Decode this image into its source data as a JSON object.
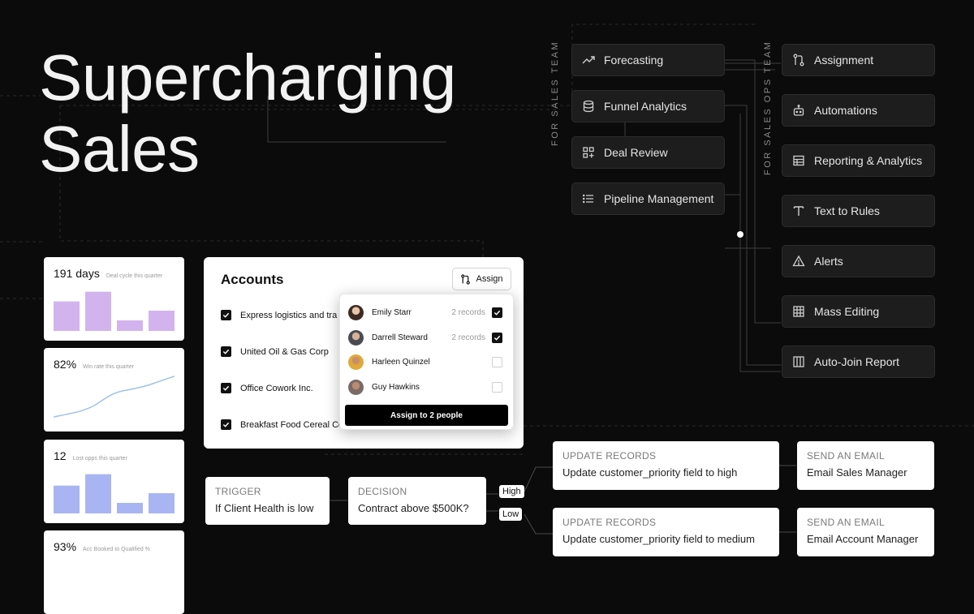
{
  "hero": {
    "line1": "Supercharging",
    "line2": "Sales"
  },
  "sales_team": {
    "label": "FOR SALES TEAM",
    "items": [
      {
        "label": "Forecasting",
        "icon": "trend-icon"
      },
      {
        "label": "Funnel Analytics",
        "icon": "database-icon"
      },
      {
        "label": "Deal Review",
        "icon": "grid-plus-icon"
      },
      {
        "label": "Pipeline Management",
        "icon": "list-icon"
      }
    ]
  },
  "sales_ops_team": {
    "label": "FOR SALES OPS TEAM",
    "items": [
      {
        "label": "Assignment",
        "icon": "git-branch-icon"
      },
      {
        "label": "Automations",
        "icon": "robot-icon"
      },
      {
        "label": "Reporting & Analytics",
        "icon": "table-icon"
      },
      {
        "label": "Text to Rules",
        "icon": "text-icon"
      },
      {
        "label": "Alerts",
        "icon": "warning-icon"
      },
      {
        "label": "Mass Editing",
        "icon": "grid-icon"
      },
      {
        "label": "Auto-Join Report",
        "icon": "columns-icon"
      }
    ]
  },
  "stats": [
    {
      "value": "191 days",
      "caption": "Deal cycle this quarter",
      "kind": "bar",
      "color": "#d3b3ee",
      "bars": [
        0.7,
        0.93,
        0.25,
        0.48
      ]
    },
    {
      "value": "82%",
      "caption": "Win rate this quarter",
      "kind": "line",
      "color": "#9fc2ea"
    },
    {
      "value": "12",
      "caption": "Lost opps this quarter",
      "kind": "bar",
      "color": "#a9b5f2",
      "bars": [
        0.66,
        0.93,
        0.25,
        0.48
      ]
    },
    {
      "value": "93%",
      "caption": "Acc Booked to Qualified %"
    }
  ],
  "accounts": {
    "title": "Accounts",
    "assign_label": "Assign",
    "rows": [
      {
        "name": "Express logistics and transport",
        "checked": true
      },
      {
        "name": "United Oil & Gas Corp",
        "checked": true
      },
      {
        "name": "Office Cowork Inc.",
        "checked": true
      },
      {
        "name": "Breakfast Food Cereal Corp",
        "checked": true
      }
    ]
  },
  "assign_popup": {
    "people": [
      {
        "name": "Emily Starr",
        "records": "2 records",
        "checked": true
      },
      {
        "name": "Darrell Steward",
        "records": "2 records",
        "checked": true
      },
      {
        "name": "Harleen Quinzel",
        "records": "",
        "checked": false
      },
      {
        "name": "Guy Hawkins",
        "records": "",
        "checked": false
      }
    ],
    "button_label": "Assign to 2 people"
  },
  "workflow": {
    "trigger": {
      "kicker": "TRIGGER",
      "text": "If Client Health is low"
    },
    "decision": {
      "kicker": "DECISION",
      "text": "Contract above $500K?"
    },
    "high_label": "High",
    "low_label": "Low",
    "update_high": {
      "kicker": "UPDATE RECORDS",
      "text": "Update customer_priority field to high"
    },
    "update_low": {
      "kicker": "UPDATE RECORDS",
      "text": "Update customer_priority field to medium"
    },
    "email_high": {
      "kicker": "SEND AN EMAIL",
      "text": "Email Sales Manager"
    },
    "email_low": {
      "kicker": "SEND AN EMAIL",
      "text": "Email Account Manager"
    }
  },
  "colors": {
    "background": "#0b0b0b",
    "pill": "#1d1d1d",
    "line": "#3a3a3a"
  }
}
